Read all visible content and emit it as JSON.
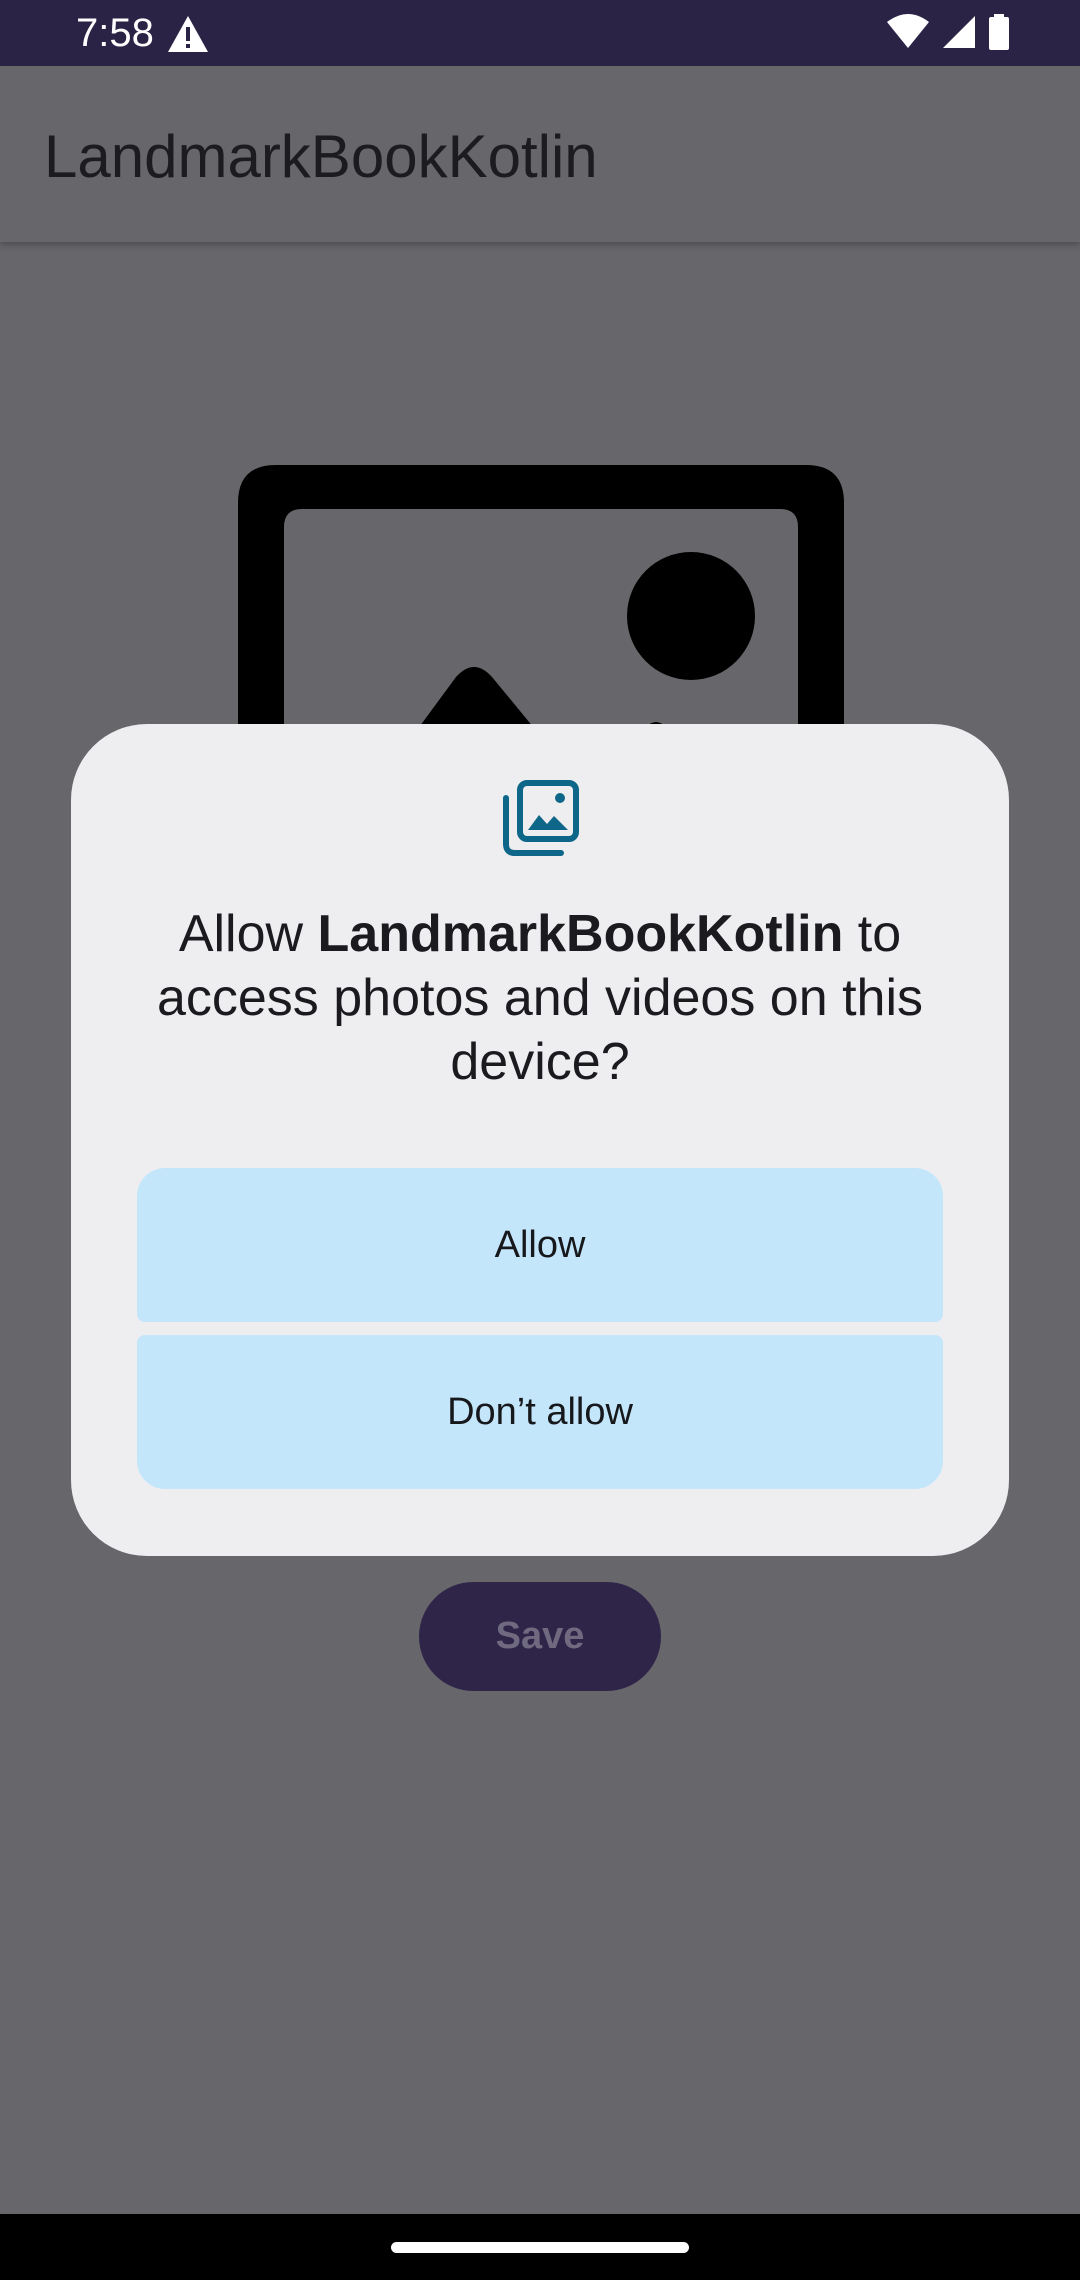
{
  "status_bar": {
    "time": "7:58",
    "icons": [
      "warning-icon",
      "wifi-icon",
      "cell-signal-icon",
      "battery-icon"
    ]
  },
  "app_bar": {
    "title": "LandmarkBookKotlin"
  },
  "main": {
    "image_placeholder_icon": "image-icon",
    "save_label": "Save"
  },
  "permission_dialog": {
    "icon": "photo-library-icon",
    "message_prefix": "Allow ",
    "app_name": "LandmarkBookKotlin",
    "message_suffix": " to access photos and videos on this device?",
    "allow_label": "Allow",
    "deny_label": "Don’t allow"
  },
  "colors": {
    "status_bar": "#2b2346",
    "scrim_background": "#67666a",
    "dialog_background": "#eeeef1",
    "dialog_button": "#c4e6fb",
    "dialog_icon": "#0e6688",
    "save_button": "#2e2549"
  }
}
